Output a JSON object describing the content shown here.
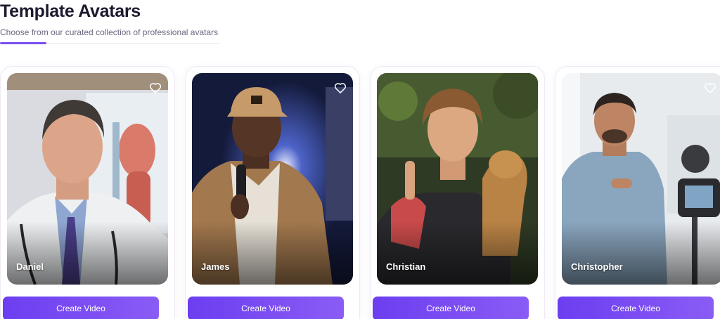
{
  "section": {
    "title": "Template Avatars",
    "subtitle": "Choose from our curated collection of professional avatars"
  },
  "avatars": [
    {
      "name": "Daniel",
      "button_label": "Create Video",
      "favorite_icon": "heart-outline-icon"
    },
    {
      "name": "James",
      "button_label": "Create Video",
      "favorite_icon": "heart-outline-icon"
    },
    {
      "name": "Christian",
      "button_label": "Create Video",
      "favorite_icon": "heart-outline-icon"
    },
    {
      "name": "Christopher",
      "button_label": "Create Video",
      "favorite_icon": "heart-outline-icon"
    }
  ],
  "colors": {
    "accent": "#7b4ff0",
    "button_start": "#6c3ef0",
    "button_end": "#8a5cf5"
  }
}
